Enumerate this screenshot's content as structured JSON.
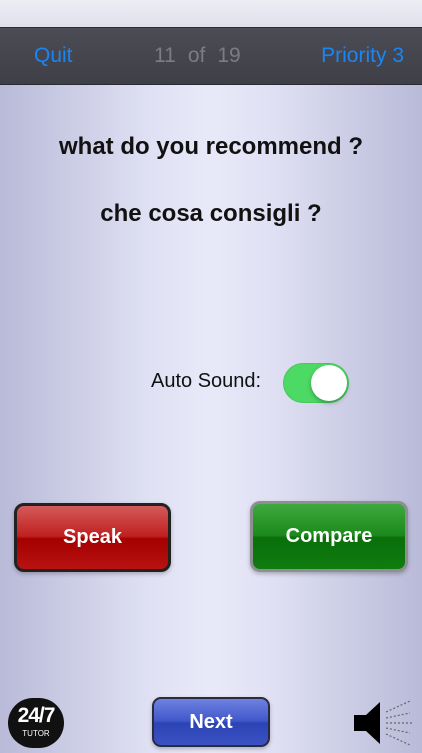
{
  "navbar": {
    "quit_label": "Quit",
    "counter_current": "11",
    "counter_of": "of",
    "counter_total": "19",
    "priority_label": "Priority 3"
  },
  "card": {
    "english": "what do you recommend ?",
    "italian": "che cosa consigli ?"
  },
  "auto_sound": {
    "label": "Auto Sound:",
    "enabled": true
  },
  "buttons": {
    "speak": "Speak",
    "compare": "Compare",
    "next": "Next"
  },
  "logo": {
    "title": "24/7",
    "subtitle": "TUTOR"
  },
  "icons": {
    "speaker": "speaker-icon"
  },
  "colors": {
    "accent_blue": "#1a86f2",
    "toggle_green": "#4cd964",
    "speak_red": "#c02020",
    "compare_green": "#1b8a1b",
    "next_blue": "#4057c9"
  }
}
